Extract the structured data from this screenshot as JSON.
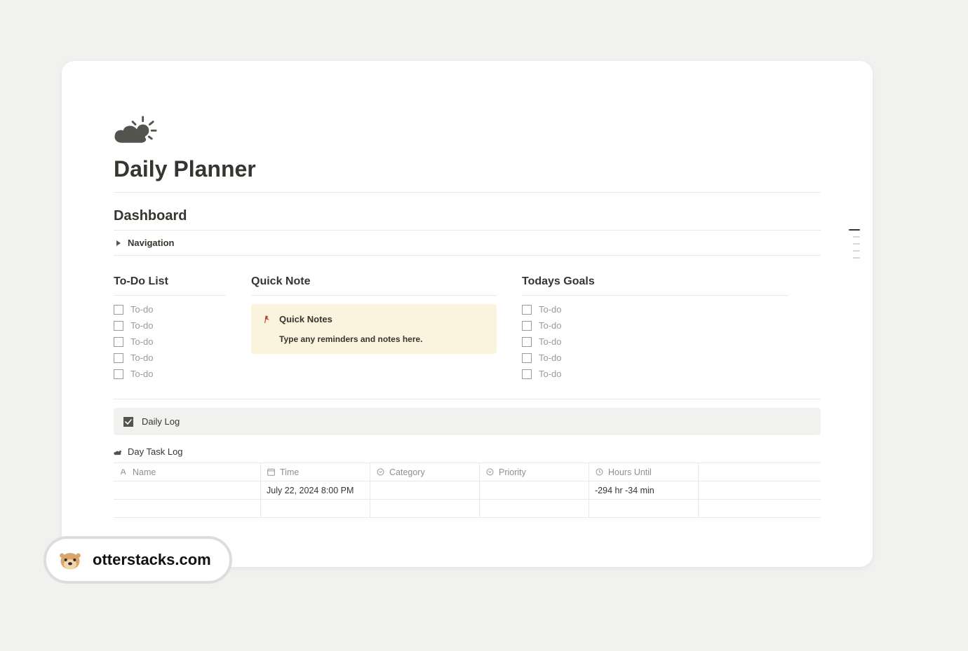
{
  "page": {
    "title": "Daily Planner",
    "section_dashboard": "Dashboard",
    "navigation_label": "Navigation"
  },
  "columns": {
    "todo": {
      "title": "To-Do List",
      "items": [
        "To-do",
        "To-do",
        "To-do",
        "To-do",
        "To-do"
      ]
    },
    "quick_note": {
      "title": "Quick Note",
      "pin_title": "Quick Notes",
      "body": "Type any reminders and notes here."
    },
    "goals": {
      "title": "Todays Goals",
      "items": [
        "To-do",
        "To-do",
        "To-do",
        "To-do",
        "To-do"
      ]
    }
  },
  "daily_log": {
    "label": "Daily Log",
    "db_title": "Day Task Log",
    "headers": {
      "name": "Name",
      "time": "Time",
      "category": "Category",
      "priority": "Priority",
      "hours_until": "Hours Until"
    },
    "rows": [
      {
        "name": "",
        "time": "July 22, 2024 8:00 PM",
        "category": "",
        "priority": "",
        "hours_until": "-294 hr -34 min"
      },
      {
        "name": "",
        "time": "",
        "category": "",
        "priority": "",
        "hours_until": ""
      }
    ]
  },
  "badge": {
    "text": "otterstacks.com"
  }
}
